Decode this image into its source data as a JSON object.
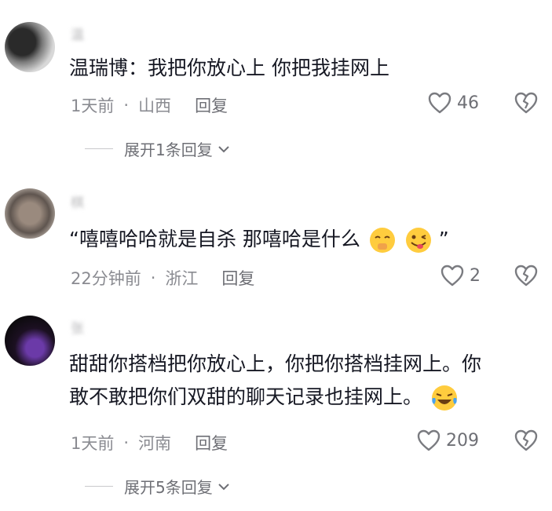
{
  "comments": [
    {
      "username": "温",
      "text": "温瑞博：我把你放心上 你把我挂网上",
      "time": "1天前",
      "location": "山西",
      "reply_label": "回复",
      "likes": "46",
      "expand_label": "展开1条回复"
    },
    {
      "username": "棋",
      "text": "“嘻嘻哈哈就是自杀 那嘻哈是什么",
      "text_end": "”",
      "time": "22分钟前",
      "location": "浙江",
      "reply_label": "回复",
      "likes": "2"
    },
    {
      "username": "张",
      "text_line1": "甜甜你搭档把你放心上，你把你搭档挂网上。你",
      "text_line2": "敢不敢把你们双甜的聊天记录也挂网上。",
      "time": "1天前",
      "location": "河南",
      "reply_label": "回复",
      "likes": "209",
      "expand_label": "展开5条回复"
    }
  ]
}
